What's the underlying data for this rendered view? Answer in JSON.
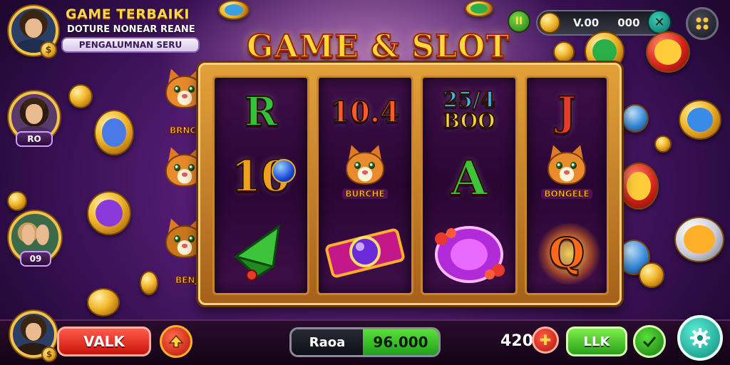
{
  "header": {
    "title": "GAME TERBAIKI",
    "subtitle": "DOTURE NONEAR REANE",
    "tag": "PENGALUMNAN SERU",
    "coin_badge": "$"
  },
  "side_players": [
    {
      "label": "RO"
    },
    {
      "label": "09"
    }
  ],
  "hud": {
    "pause_label": "II",
    "coin_value": "V.00",
    "coin_amount": "000",
    "close_label": "✕",
    "menu_icon": "dots-grid-icon"
  },
  "game_title": "GAME & SLOT",
  "reels": [
    {
      "symbols": [
        {
          "kind": "letter",
          "text": "R",
          "color": "#33c23a"
        },
        {
          "kind": "letter",
          "text": "10",
          "color": "#f0a020"
        },
        {
          "kind": "gem",
          "icon": "green-leaf-icon"
        }
      ]
    },
    {
      "symbols": [
        {
          "kind": "letter",
          "text": "10.4",
          "color": "#ff5a2a"
        },
        {
          "kind": "cat",
          "label": "BURCHE"
        },
        {
          "kind": "gem",
          "icon": "orb-ticket-icon"
        }
      ]
    },
    {
      "symbols": [
        {
          "kind": "letter",
          "text": "25/4",
          "sub": "BOO",
          "color": "#3fb6e8"
        },
        {
          "kind": "letter",
          "text": "A",
          "color": "#3ec43a"
        },
        {
          "kind": "gem",
          "icon": "purple-jewel-icon"
        }
      ]
    },
    {
      "symbols": [
        {
          "kind": "letter",
          "text": "J",
          "color": "#e83a2a"
        },
        {
          "kind": "cat",
          "label": "BONGELE"
        },
        {
          "kind": "letter",
          "text": "Q",
          "color": "#ff6a1a"
        }
      ]
    }
  ],
  "side_cats": [
    "BRNCE",
    "BENJ"
  ],
  "bottom": {
    "action_label": "VALK",
    "up_icon": "arrow-up-icon",
    "balance_label": "Raoa",
    "balance_value": "96.000",
    "bet_value": "420",
    "minus_icon": "plus-icon",
    "spin_label": "LLK",
    "check_icon": "check-icon",
    "settings_icon": "gear-icon",
    "avatar_badge": "$"
  },
  "colors": {
    "accent_gold": "#ffd54a",
    "action_red": "#d8241c",
    "balance_green": "#28c02a",
    "settings_teal": "#1fb9a8"
  }
}
